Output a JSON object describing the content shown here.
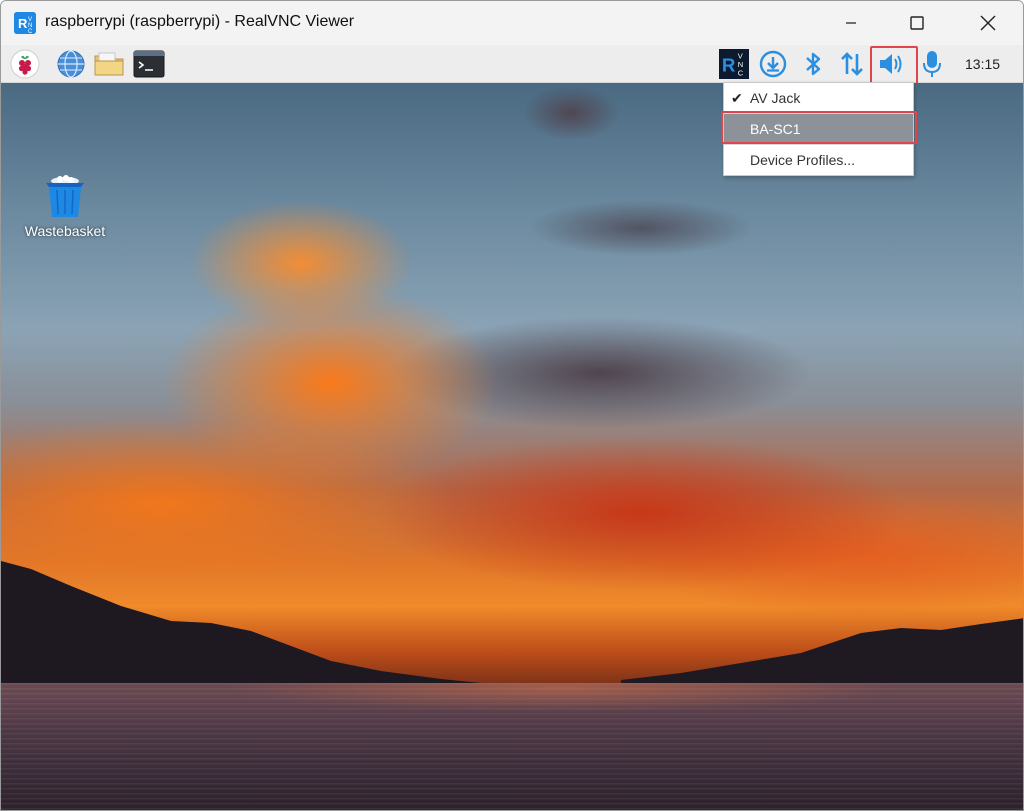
{
  "window": {
    "title": "raspberrypi (raspberrypi) - RealVNC Viewer"
  },
  "panel": {
    "clock": "13:15"
  },
  "desktop": {
    "icons": [
      {
        "label": "Wastebasket"
      }
    ]
  },
  "audio_menu": {
    "items": [
      {
        "label": "AV Jack",
        "checked": true
      },
      {
        "label": "BA-SC1",
        "checked": false,
        "hovered": true
      },
      {
        "label": "Device Profiles..."
      }
    ]
  },
  "colors": {
    "highlight": "#e0454b",
    "tray_blue": "#2a8fe0",
    "menu_selected": "#8d9198"
  }
}
